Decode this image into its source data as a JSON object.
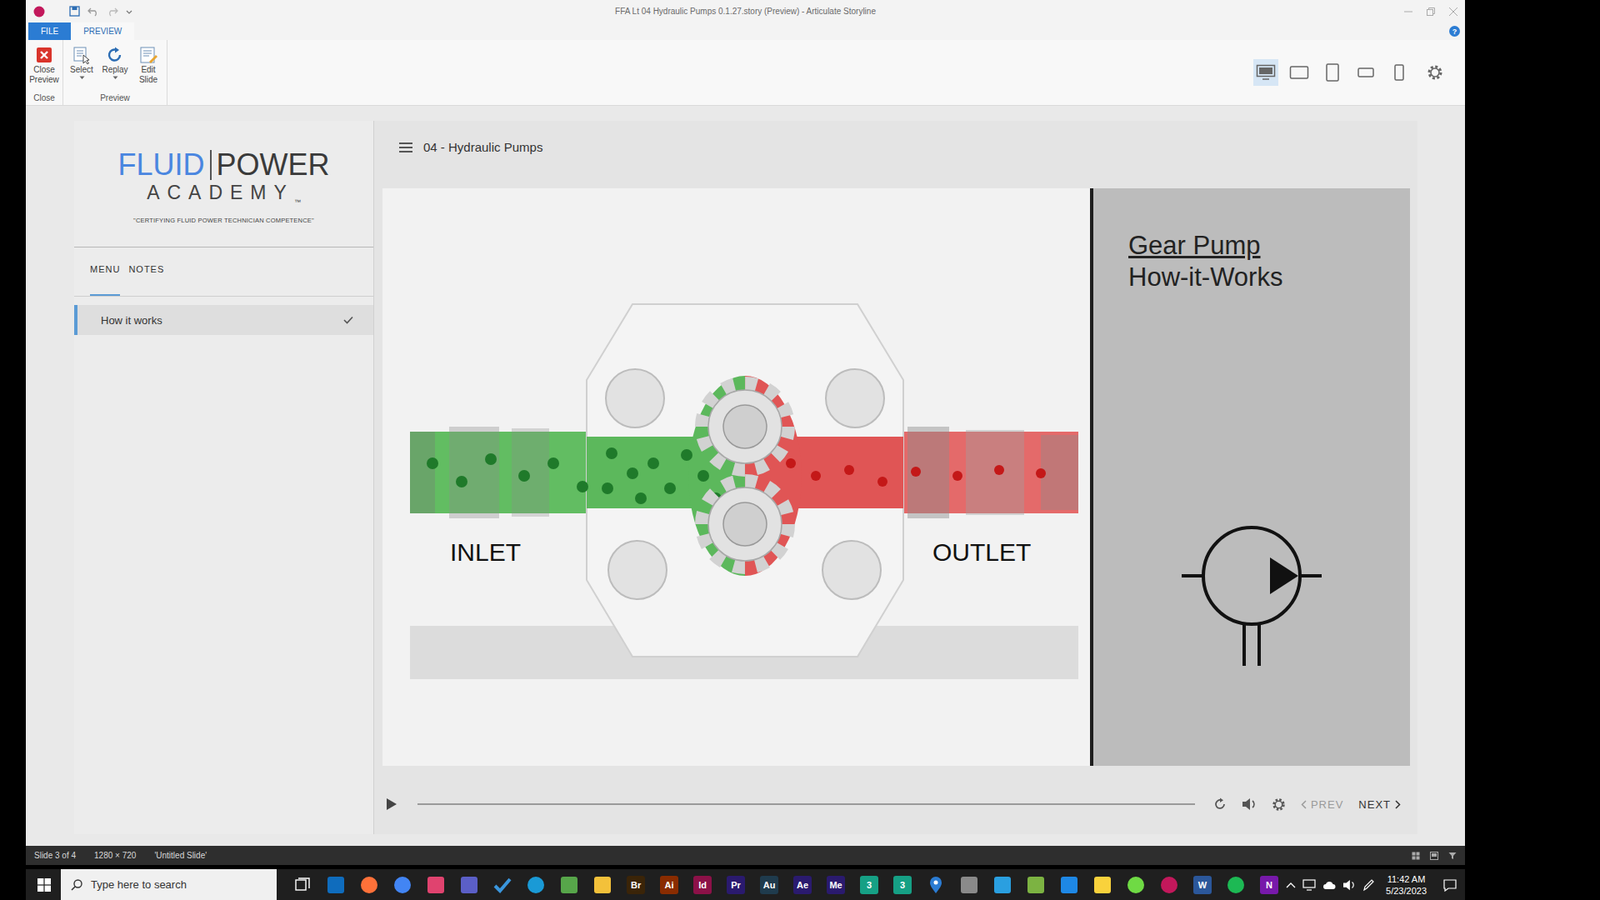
{
  "window": {
    "title": "FFA Lt 04 Hydraulic Pumps 0.1.27.story (Preview) - Articulate Storyline"
  },
  "ribbon": {
    "tabs": [
      {
        "label": "FILE",
        "kind": "file",
        "selected": false
      },
      {
        "label": "PREVIEW",
        "kind": "tab",
        "selected": true
      }
    ],
    "help": "?",
    "groups": [
      {
        "label": "Close",
        "buttons": [
          {
            "label": "Close Preview",
            "kind": "close",
            "dropdown": false
          }
        ]
      },
      {
        "label": "Preview",
        "buttons": [
          {
            "label": "Select",
            "kind": "select",
            "dropdown": true
          },
          {
            "label": "Replay",
            "kind": "replay",
            "dropdown": true
          },
          {
            "label": "Edit Slide",
            "kind": "edit",
            "dropdown": false
          }
        ]
      }
    ],
    "devices": [
      {
        "kind": "desktop",
        "selected": true
      },
      {
        "kind": "tablet-landscape",
        "selected": false
      },
      {
        "kind": "tablet-portrait",
        "selected": false
      },
      {
        "kind": "phone-landscape",
        "selected": false
      },
      {
        "kind": "phone-portrait",
        "selected": false
      }
    ]
  },
  "player": {
    "logo": {
      "word1": "FLUID",
      "word2": "POWER",
      "word3": "ACADEMY",
      "mark": "™",
      "tagline": "\"CERTIFYING FLUID POWER TECHNICIAN COMPETENCE\""
    },
    "sidebar_tabs": [
      {
        "label": "MENU",
        "selected": true
      },
      {
        "label": "NOTES",
        "selected": false
      }
    ],
    "menu": [
      {
        "label": "How it works",
        "selected": true,
        "visited": true
      }
    ],
    "course_title": "04 - Hydraulic Pumps",
    "slide": {
      "title": "Gear Pump",
      "subtitle": "How-it-Works",
      "inlet": "INLET",
      "outlet": "OUTLET"
    },
    "controls": {
      "playing": false,
      "level": 0,
      "prev": {
        "label": "PREV",
        "disabled": true
      },
      "next": {
        "label": "NEXT",
        "disabled": false
      }
    }
  },
  "status_bar": [
    "Slide 3 of 4",
    "1280 × 720",
    "'Untitled Slide'"
  ],
  "taskbar": {
    "search": {
      "placeholder": "Type here to search"
    },
    "apps": [
      {
        "kind": "square",
        "color": "#0f6cbd"
      },
      {
        "kind": "circle",
        "color": "#ff7139"
      },
      {
        "kind": "circle",
        "color": "#4285f4"
      },
      {
        "kind": "square",
        "color": "#e0436f"
      },
      {
        "kind": "square",
        "color": "#5b5fc7"
      },
      {
        "kind": "check",
        "color": "#3a96dd"
      },
      {
        "kind": "circle",
        "color": "#1a9ad6"
      },
      {
        "kind": "square",
        "color": "#57a64a"
      },
      {
        "kind": "square",
        "color": "#f3c13a"
      },
      {
        "kind": "letter",
        "glyph": "Br",
        "color": "#3a2408"
      },
      {
        "kind": "letter",
        "glyph": "Ai",
        "color": "#8a2c00"
      },
      {
        "kind": "letter",
        "glyph": "Id",
        "color": "#8c1148"
      },
      {
        "kind": "letter",
        "glyph": "Pr",
        "color": "#2a1a6e"
      },
      {
        "kind": "letter",
        "glyph": "Au",
        "color": "#1f3b4d"
      },
      {
        "kind": "letter",
        "glyph": "Ae",
        "color": "#2a1a6e"
      },
      {
        "kind": "letter",
        "glyph": "Me",
        "color": "#2a1a6e"
      },
      {
        "kind": "letter",
        "glyph": "3",
        "color": "#16a085"
      },
      {
        "kind": "letter",
        "glyph": "3",
        "color": "#16a085"
      },
      {
        "kind": "pin",
        "color": "#2b7cd3"
      },
      {
        "kind": "square",
        "color": "#8a8a8a"
      },
      {
        "kind": "square",
        "color": "#2a9fe0"
      },
      {
        "kind": "square",
        "color": "#7cb342"
      },
      {
        "kind": "square",
        "color": "#1e88e5"
      },
      {
        "kind": "square",
        "color": "#f9d23c"
      },
      {
        "kind": "circle",
        "color": "#6fda44"
      },
      {
        "kind": "circle",
        "color": "#c2185b"
      },
      {
        "kind": "letter",
        "glyph": "W",
        "color": "#2b579a"
      },
      {
        "kind": "circle",
        "color": "#1db954"
      },
      {
        "kind": "letter",
        "glyph": "N",
        "color": "#7719aa"
      }
    ],
    "time": "11:42 AM",
    "date": "5/23/2023"
  }
}
